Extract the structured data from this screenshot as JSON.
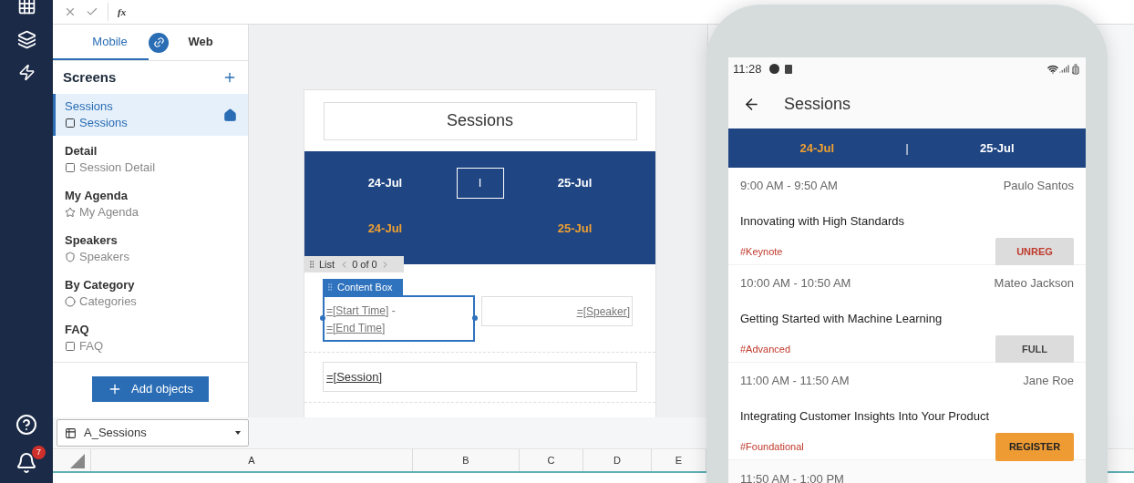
{
  "formula_bar": {
    "fx": "fx"
  },
  "nav": {
    "notification_count": "7"
  },
  "platform_tabs": [
    {
      "label": "Mobile",
      "selected": true
    },
    {
      "label": "Web",
      "selected": false
    }
  ],
  "screens": {
    "title": "Screens",
    "items": [
      {
        "name": "Sessions",
        "page": "Sessions",
        "kind": "page",
        "selected": true,
        "home": true
      },
      {
        "name": "Detail",
        "page": "Session Detail",
        "kind": "page",
        "selected": false,
        "home": false
      },
      {
        "name": "My Agenda",
        "page": "My Agenda",
        "kind": "favorites",
        "selected": false,
        "home": false
      },
      {
        "name": "Speakers",
        "page": "Speakers",
        "kind": "people",
        "selected": false,
        "home": false
      },
      {
        "name": "By Category",
        "page": "Categories",
        "kind": "category",
        "selected": false,
        "home": false
      },
      {
        "name": "FAQ",
        "page": "FAQ",
        "kind": "page",
        "selected": false,
        "home": false
      }
    ]
  },
  "add_button": "Add objects",
  "canvas": {
    "header": "Sessions",
    "divider": "I",
    "date_rows": [
      {
        "kind": "default",
        "labels": [
          "24-Jul",
          "25-Jul"
        ]
      },
      {
        "kind": "selected",
        "labels": [
          "24-Jul",
          "25-Jul"
        ]
      }
    ],
    "list_label": "List",
    "list_count": "0 of 0",
    "content_box_label": "Content Box",
    "start_time": "=[Start Time]",
    "dash": "-",
    "end_time": "=[End Time]",
    "speaker": "=[Speaker]",
    "session": "=[Session]"
  },
  "sheet": {
    "name": "A_Sessions",
    "columns": [
      "A",
      "B",
      "C",
      "D",
      "E"
    ]
  },
  "phone": {
    "time": "11:28",
    "title": "Sessions",
    "divider": "|",
    "tabs": [
      {
        "label": "24-Jul",
        "selected": true
      },
      {
        "label": "25-Jul",
        "selected": false
      }
    ],
    "sessions": [
      {
        "time": "9:00 AM - 9:50 AM",
        "speaker": "Paulo Santos",
        "title": "Innovating with High Standards",
        "tag": "#Keynote",
        "action": {
          "label": "UNREG",
          "kind": "unreg"
        }
      },
      {
        "time": "10:00 AM - 10:50 AM",
        "speaker": "Mateo Jackson",
        "title": "Getting Started with Machine Learning",
        "tag": "#Advanced",
        "action": {
          "label": "FULL",
          "kind": "full"
        }
      },
      {
        "time": "11:00 AM - 11:50 AM",
        "speaker": "Jane Roe",
        "title": "Integrating Customer Insights Into Your Product",
        "tag": "#Foundational",
        "action": {
          "label": "REGISTER",
          "kind": "register"
        }
      }
    ],
    "next_time": "11:50 AM - 1:00 PM"
  }
}
